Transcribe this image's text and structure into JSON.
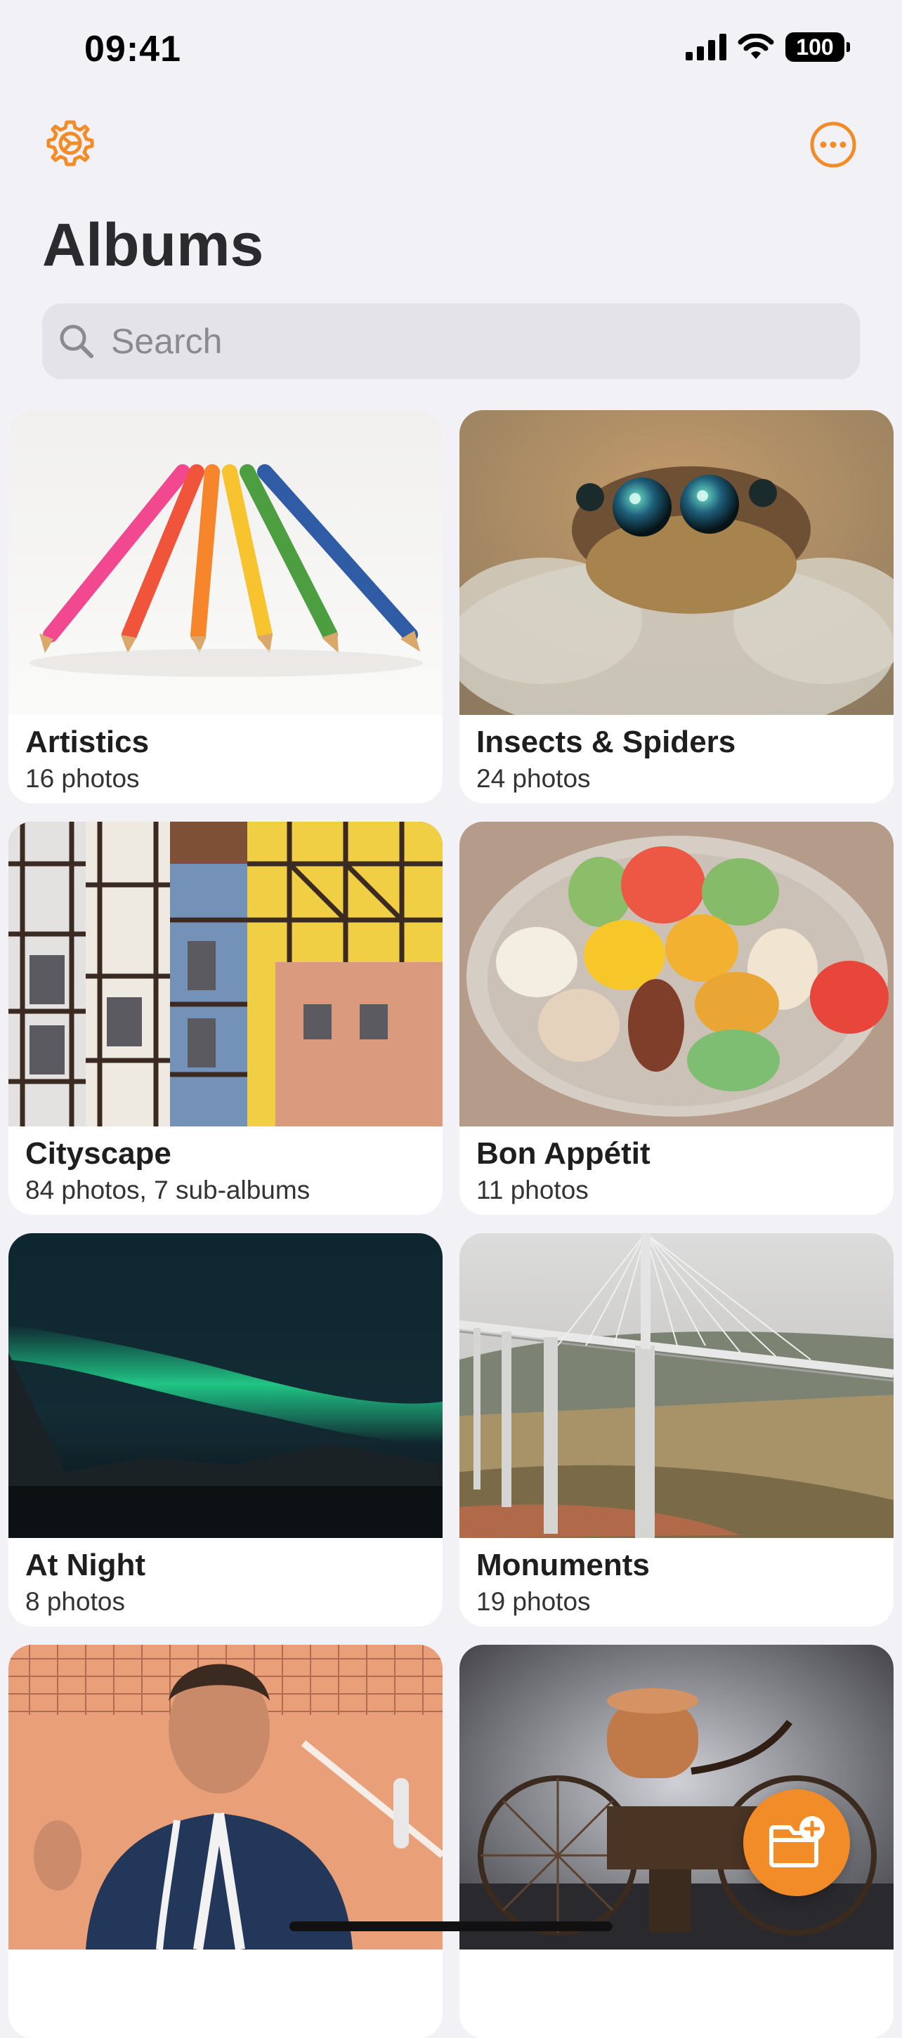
{
  "status_bar": {
    "time": "09:41",
    "battery": "100"
  },
  "header": {
    "title": "Albums",
    "settings_icon": "gear-icon",
    "more_icon": "ellipsis-circle-icon"
  },
  "search": {
    "placeholder": "Search",
    "value": ""
  },
  "albums": [
    {
      "name": "Artistics",
      "count": "16 photos",
      "thumb": "colored-pencils"
    },
    {
      "name": "Insects & Spiders",
      "count": "24 photos",
      "thumb": "jumping-spider"
    },
    {
      "name": "Cityscape",
      "count": "84 photos, 7 sub-albums",
      "thumb": "timber-houses"
    },
    {
      "name": "Bon Appétit",
      "count": "11 photos",
      "thumb": "macarons"
    },
    {
      "name": "At Night",
      "count": "8 photos",
      "thumb": "aurora"
    },
    {
      "name": "Monuments",
      "count": "19 photos",
      "thumb": "viaduct"
    },
    {
      "name": "",
      "count": "",
      "thumb": "tennis-player"
    },
    {
      "name": "",
      "count": "",
      "thumb": "vintage-motorcycle"
    }
  ],
  "fab": {
    "icon": "add-folder-icon"
  },
  "colors": {
    "accent": "#F28C28",
    "background": "#F2F1F6",
    "card": "#FFFFFF"
  }
}
